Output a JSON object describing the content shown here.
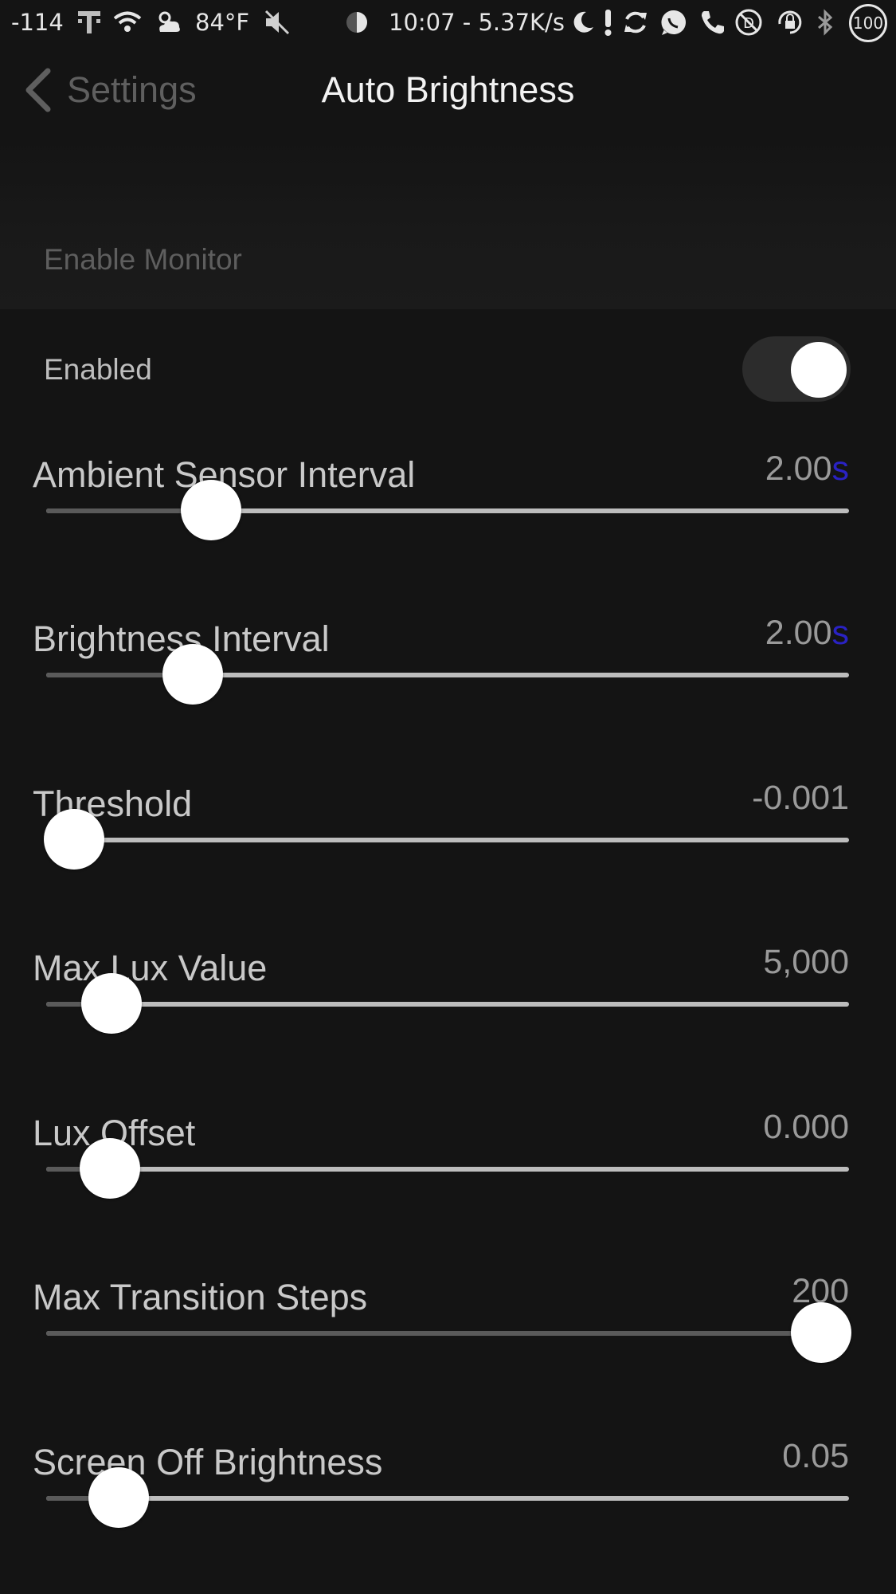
{
  "status_bar": {
    "signal": "-114",
    "carrier_icon": "t-mobile-icon",
    "weather": "84°F",
    "time_speed": "10:07 - 5.37K/s",
    "battery": "100"
  },
  "nav": {
    "back_label": "Settings",
    "title": "Auto Brightness"
  },
  "section": {
    "header": "Enable Monitor"
  },
  "toggle": {
    "label": "Enabled",
    "on": true
  },
  "sliders": [
    {
      "label": "Ambient Sensor Interval",
      "value": "2.00",
      "unit": "s",
      "fraction": 0.205
    },
    {
      "label": "Brightness Interval",
      "value": "2.00",
      "unit": "s",
      "fraction": 0.183
    },
    {
      "label": "Threshold",
      "value": "-0.001",
      "unit": "",
      "fraction": 0.035
    },
    {
      "label": "Max Lux Value",
      "value": "5,000",
      "unit": "",
      "fraction": 0.081
    },
    {
      "label": "Lux Offset",
      "value": "0.000",
      "unit": "",
      "fraction": 0.079
    },
    {
      "label": "Max Transition Steps",
      "value": "200",
      "unit": "",
      "fraction": 0.965
    },
    {
      "label": "Screen Off Brightness",
      "value": "0.05",
      "unit": "",
      "fraction": 0.09
    }
  ],
  "colors": {
    "background": "#141414",
    "unit_accent": "#2a22c4",
    "thumb": "#ffffff"
  }
}
